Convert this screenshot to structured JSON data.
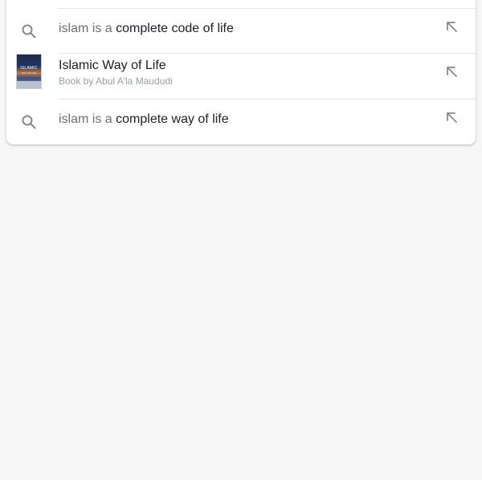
{
  "suggestions": [
    {
      "type": "query",
      "icon": "search-icon",
      "prefix": "islam is a",
      "completion": "complete code of life",
      "action_icon": "fill-query-arrow-icon"
    },
    {
      "type": "entity",
      "icon": "book-cover-thumbnail",
      "thumbnail_text": "ISLAMIC",
      "thumbnail_subtext": "WAY OF LIFE",
      "title": "Islamic Way of Life",
      "subtitle": "Book by Abul A'la Maududi",
      "action_icon": "fill-query-arrow-icon"
    },
    {
      "type": "query",
      "icon": "search-icon",
      "prefix": "islam is a",
      "completion": "complete way of life",
      "action_icon": "fill-query-arrow-icon"
    }
  ],
  "colors": {
    "background": "#f6f6f6",
    "card": "#ffffff",
    "text_primary": "#202124",
    "text_secondary": "#6f6f6f",
    "text_tertiary": "#9aa0a6",
    "icon": "#8a8a8a"
  }
}
